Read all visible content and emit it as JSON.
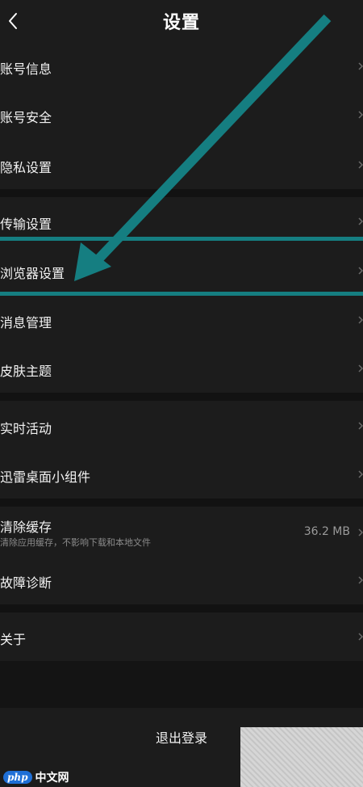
{
  "header": {
    "title": "设置"
  },
  "groups": [
    {
      "items": [
        {
          "label": "账号信息"
        },
        {
          "label": "账号安全"
        },
        {
          "label": "隐私设置"
        }
      ]
    },
    {
      "items": [
        {
          "label": "传输设置"
        },
        {
          "label": "浏览器设置"
        },
        {
          "label": "消息管理"
        },
        {
          "label": "皮肤主题"
        }
      ]
    },
    {
      "items": [
        {
          "label": "实时活动"
        },
        {
          "label": "迅雷桌面小组件"
        }
      ]
    },
    {
      "items": [
        {
          "label": "清除缓存",
          "subtitle": "清除应用缓存，不影响下载和本地文件",
          "value": "36.2 MB"
        },
        {
          "label": "故障诊断"
        }
      ]
    },
    {
      "items": [
        {
          "label": "关于"
        }
      ]
    }
  ],
  "logout": {
    "label": "退出登录"
  },
  "watermark": {
    "badge": "php",
    "text": "中文网"
  },
  "colors": {
    "highlight": "#157e81",
    "background": "#1c1c1c",
    "gap": "#121212"
  }
}
